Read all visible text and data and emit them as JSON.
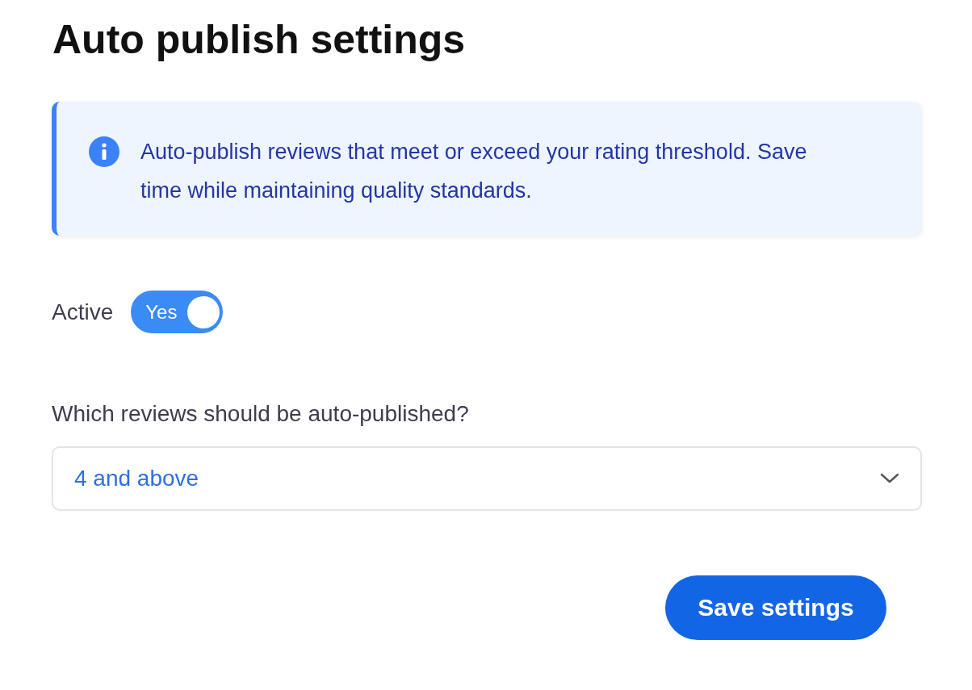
{
  "title": "Auto publish settings",
  "info": {
    "text": "Auto-publish reviews that meet or exceed your rating threshold. Save time while maintaining quality standards."
  },
  "active": {
    "label": "Active",
    "on": true,
    "on_text": "Yes"
  },
  "question": {
    "label": "Which reviews should be auto-published?",
    "value": "4 and above"
  },
  "save_button": "Save settings"
}
